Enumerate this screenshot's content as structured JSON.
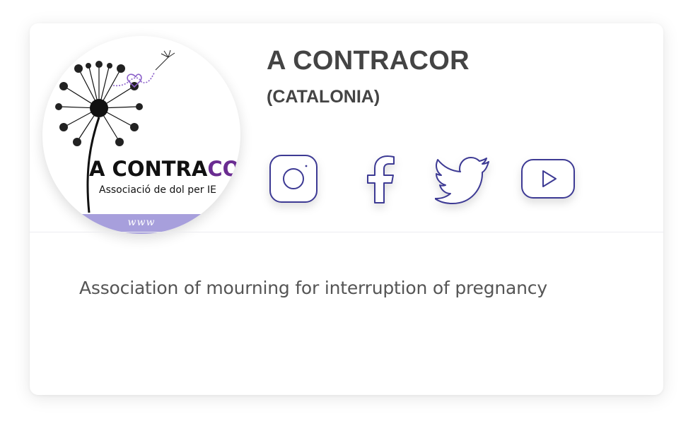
{
  "profile": {
    "name": "A CONTRACOR",
    "region": "(CATALONIA)",
    "description": "Association of mourning for interruption of pregnancy",
    "logo": {
      "text_main_black": "A CONTRA",
      "text_main_purple": "COR",
      "tagline": "Associació de dol per IE",
      "band_text": "www"
    }
  },
  "social_links": [
    {
      "icon": "instagram-icon",
      "label": "Instagram"
    },
    {
      "icon": "facebook-icon",
      "label": "Facebook"
    },
    {
      "icon": "twitter-icon",
      "label": "Twitter"
    },
    {
      "icon": "youtube-icon",
      "label": "YouTube"
    }
  ],
  "colors": {
    "icon_stroke": "#3d3a94",
    "band": "#a79fdc",
    "logo_purple": "#6a2c91",
    "text": "#444444"
  }
}
